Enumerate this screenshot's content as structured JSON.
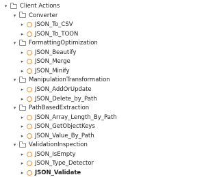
{
  "tree": {
    "root": {
      "label": "Client Actions"
    },
    "groups": [
      {
        "label": "Converter",
        "items": [
          "JSON_To_CSV",
          "JSON_To_TOON"
        ]
      },
      {
        "label": "FormattingOptimization",
        "items": [
          "JSON_Beautify",
          "JSON_Merge",
          "JSON_Minify"
        ]
      },
      {
        "label": "ManipulationTransformation",
        "items": [
          "JSON_AddOrUpdate",
          "JSON_Delete_by_Path"
        ]
      },
      {
        "label": "PathBasedExtraction",
        "items": [
          "JSON_Array_Length_By_Path",
          "JSON_GetObjectKeys",
          "JSON_Value_By_Path"
        ]
      },
      {
        "label": "ValidationInspection",
        "items": [
          "JSON_IsEmpty",
          "JSON_Type_Detector",
          "JSON_Validate"
        ]
      }
    ],
    "selected_item": "JSON_Validate",
    "icons": {
      "expanded": "chevron-down-icon",
      "collapsed": "chevron-right-icon",
      "folder": "folder-icon",
      "action": "client-action-icon"
    },
    "colors": {
      "action_icon": "#e8913a"
    }
  }
}
